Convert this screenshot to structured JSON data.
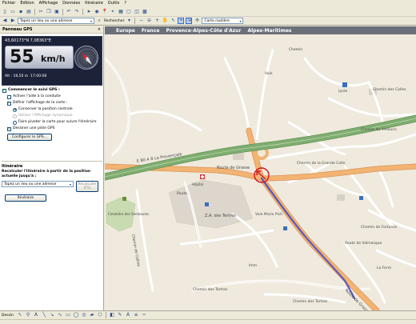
{
  "menu": [
    "Fichier",
    "Edition",
    "Affichage",
    "Données",
    "Itinéraire",
    "Outils",
    "?"
  ],
  "toolbar": {
    "address_placeholder": "Tapez un lieu ou une adresse",
    "search_button": "Rechercher",
    "map_style": "Carte routière"
  },
  "panel": {
    "title": "Panneau GPS",
    "close": "×",
    "coords": "43,60173°N 7,08363°E",
    "speed_value": "55",
    "speed_unit": "km/h",
    "altitude": "Alt : 18,50 m",
    "time": "17:00:08",
    "start_gps": "Commencer le suivi GPS :",
    "options": [
      {
        "label": "Activer l'aide à la conduite",
        "checked": false,
        "kind": "checkbox"
      },
      {
        "label": "Définir l'affichage de la carte :",
        "checked": true,
        "kind": "checkbox"
      }
    ],
    "sub_options": [
      {
        "label": "Conserver la position centrale",
        "checked": true,
        "disabled": false
      },
      {
        "label": "Utiliser l'Affichage dynamique",
        "checked": false,
        "disabled": true
      },
      {
        "label": "Faire pivoter la carte pour suivre l'itinéraire",
        "checked": false,
        "disabled": false
      }
    ],
    "draw_trail": "Dessiner une piste GPS",
    "config_button": "Configurer le GPS...",
    "itin_title": "Itinéraire",
    "recalc_text": "Recalculer l'itinéraire à partir de la position actuelle jusqu'à :",
    "itin_input_placeholder": "Tapez un lieu ou une adresse",
    "recalc_button": "Recalculer (F5)",
    "itin_button": "Itinéraire"
  },
  "map": {
    "breadcrumb": [
      "Europe",
      "France",
      "Provence-Alpes-Côte d'Azur",
      "Alpes-Maritimes"
    ],
    "labels": {
      "motorway": "E 80  A 8  La Provençale",
      "route_grasse": "Route de Grasse",
      "route_grasse2": "Route de Grasse",
      "za_tertres": "Z.A. des Tertres",
      "voie_mario": "Voie Mario Pich",
      "chemin_tertres1": "Chemin des Tertres",
      "chemin_tertres2": "Chemin des Tertres",
      "chemin_vallauris": "Chemin du Vallauris",
      "chemin_gd_colle": "Chemin de la Grande Colle",
      "chemin_colles": "Chemin des Colles",
      "chemin_fortunes": "Chemin de Fortunes",
      "route_valmasque": "Route de Valmasque",
      "lycee": "Lycée",
      "cimetiere": "Cimetière des Semboules",
      "la_ferre": "La Ferre",
      "chemin_mont": "Chemin",
      "colline": "Chemin de Colline",
      "voie": "Voie",
      "route": "Route",
      "hopital": "Hôpital",
      "imm": "Imm"
    }
  },
  "drawbar": {
    "dessin_label": "Dessin"
  },
  "colors": {
    "motorway": "#7fae70",
    "major_road": "#f2b373",
    "local_road": "#ffffff",
    "background": "#efeadd",
    "route": "#2d2fa6",
    "gps_marker": "#d0111a",
    "cemetery": "#c9dbb0",
    "industrial": "#dcd6cc"
  }
}
